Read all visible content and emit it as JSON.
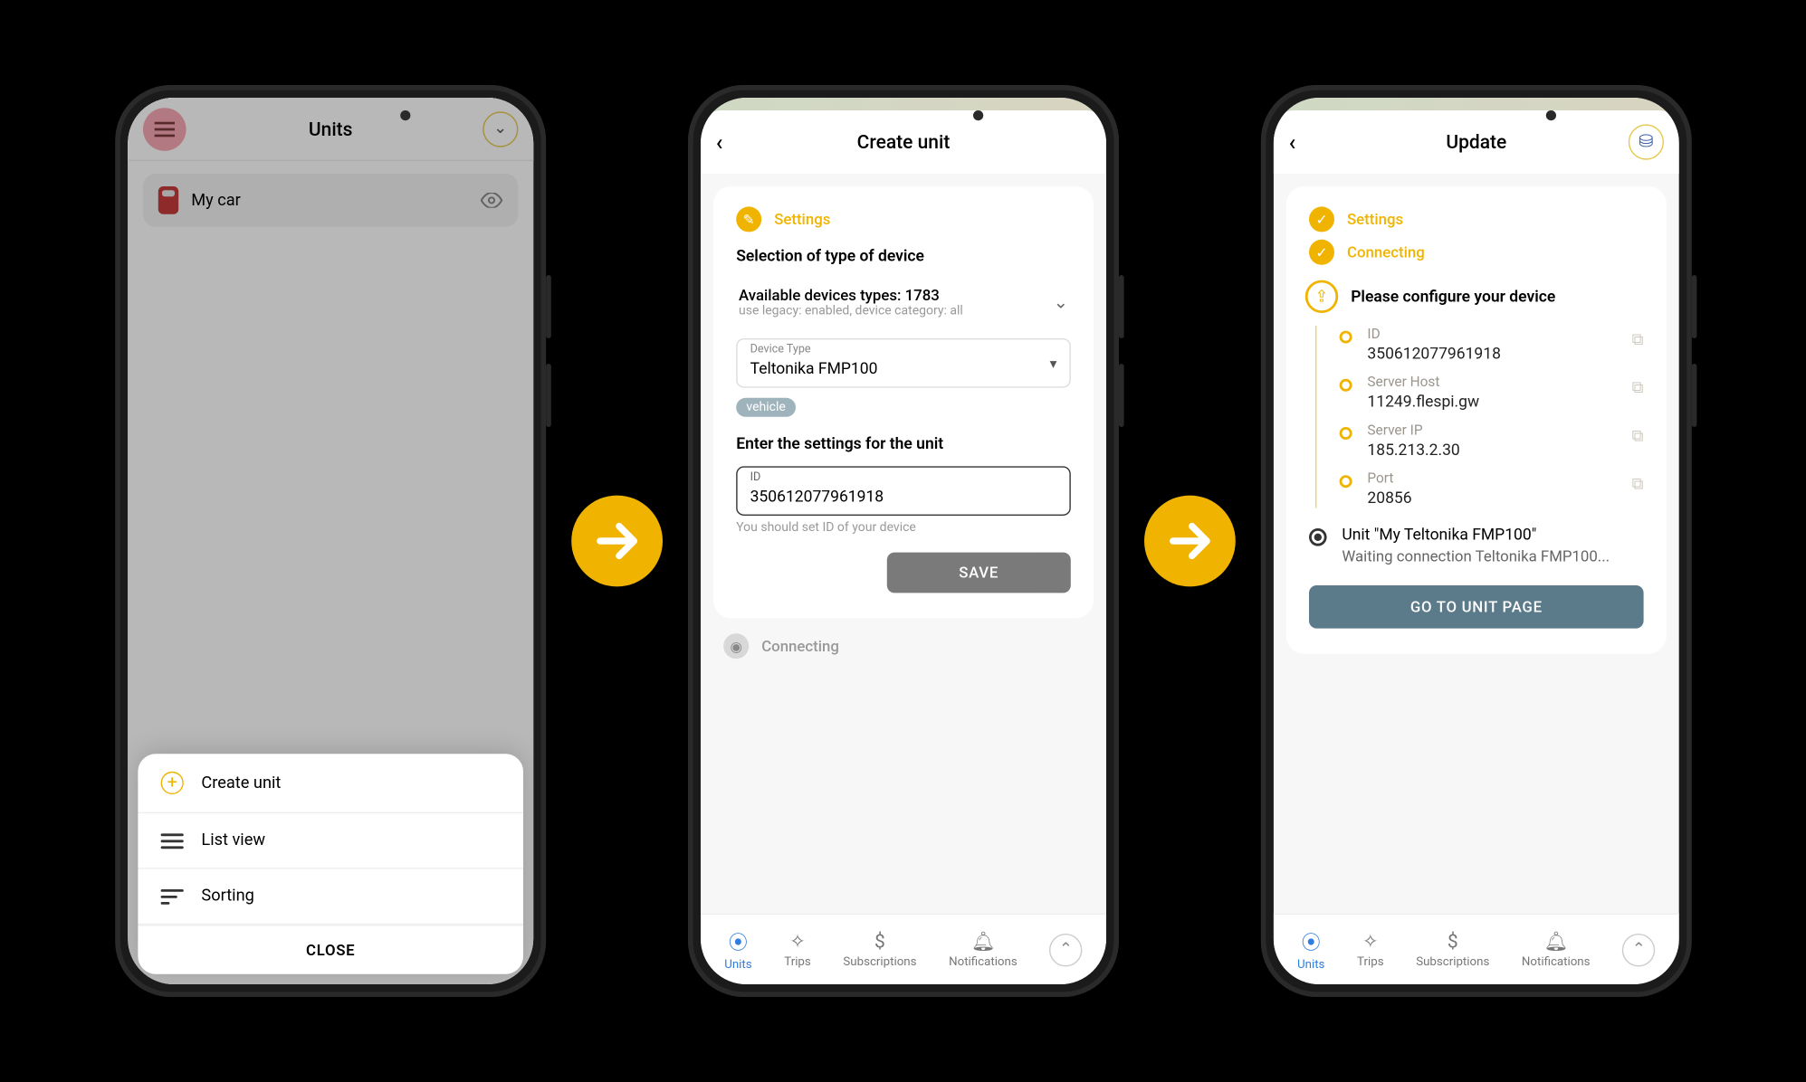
{
  "screen1": {
    "title": "Units",
    "unit_name": "My car",
    "sheet": {
      "create": "Create unit",
      "list": "List view",
      "sort": "Sorting",
      "close": "CLOSE"
    }
  },
  "screen2": {
    "title": "Create unit",
    "step_settings": "Settings",
    "step_connecting": "Connecting",
    "section1_title": "Selection of type of device",
    "avail_line": "Available devices types: 1783",
    "avail_sub": "use legacy: enabled, device category: all",
    "device_type_label": "Device Type",
    "device_type_value": "Teltonika FMP100",
    "chip": "vehicle",
    "section2_title": "Enter the settings for the unit",
    "id_label": "ID",
    "id_value": "350612077961918",
    "id_hint": "You should set ID of your device",
    "save": "SAVE"
  },
  "screen3": {
    "title": "Update",
    "step_settings": "Settings",
    "step_connecting": "Connecting",
    "configure_title": "Please configure your device",
    "fields": {
      "id_k": "ID",
      "id_v": "350612077961918",
      "host_k": "Server Host",
      "host_v": "11249.flespi.gw",
      "ip_k": "Server IP",
      "ip_v": "185.213.2.30",
      "port_k": "Port",
      "port_v": "20856"
    },
    "unit_line": "Unit \"My Teltonika FMP100\"",
    "wait_line": "Waiting connection Teltonika FMP100...",
    "goto": "GO TO UNIT PAGE"
  },
  "tabs": {
    "units": "Units",
    "trips": "Trips",
    "subs": "Subscriptions",
    "notif": "Notifications"
  }
}
